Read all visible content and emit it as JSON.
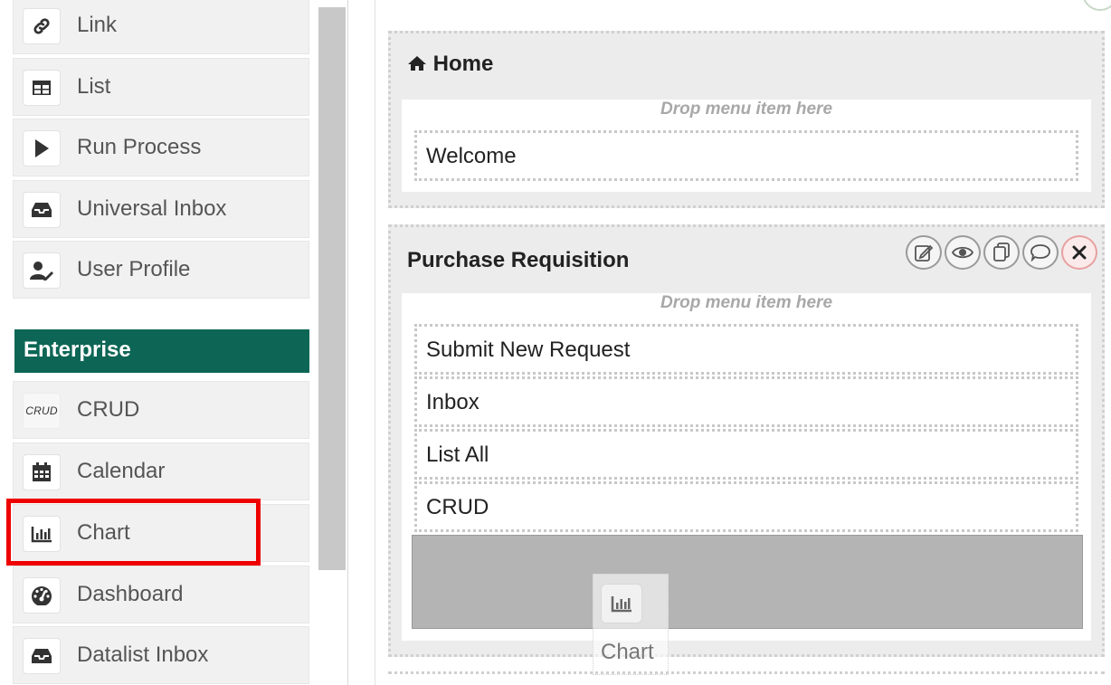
{
  "palette": {
    "items_top": [
      {
        "label": "Link",
        "icon": "link-icon"
      },
      {
        "label": "List",
        "icon": "table-icon"
      },
      {
        "label": "Run Process",
        "icon": "play-icon"
      },
      {
        "label": "Universal Inbox",
        "icon": "inbox-icon"
      },
      {
        "label": "User Profile",
        "icon": "user-edit-icon"
      }
    ],
    "section_title": "Enterprise",
    "items_enterprise": [
      {
        "label": "CRUD",
        "icon_text": "CRUD"
      },
      {
        "label": "Calendar",
        "icon": "calendar-icon"
      },
      {
        "label": "Chart",
        "icon": "bar-chart-icon"
      },
      {
        "label": "Dashboard",
        "icon": "dashboard-icon"
      },
      {
        "label": "Datalist Inbox",
        "icon": "inbox-icon"
      }
    ]
  },
  "canvas": {
    "categories": [
      {
        "title": "Home",
        "drop_hint": "Drop menu item here",
        "items": [
          "Welcome"
        ]
      },
      {
        "title": "Purchase Requisition",
        "drop_hint": "Drop menu item here",
        "items": [
          "Submit New Request",
          "Inbox",
          "List All",
          "CRUD"
        ]
      }
    ],
    "drag_ghost_label": "Chart"
  },
  "colors": {
    "section_bg": "#0d6655",
    "highlight": "#ee0000"
  }
}
